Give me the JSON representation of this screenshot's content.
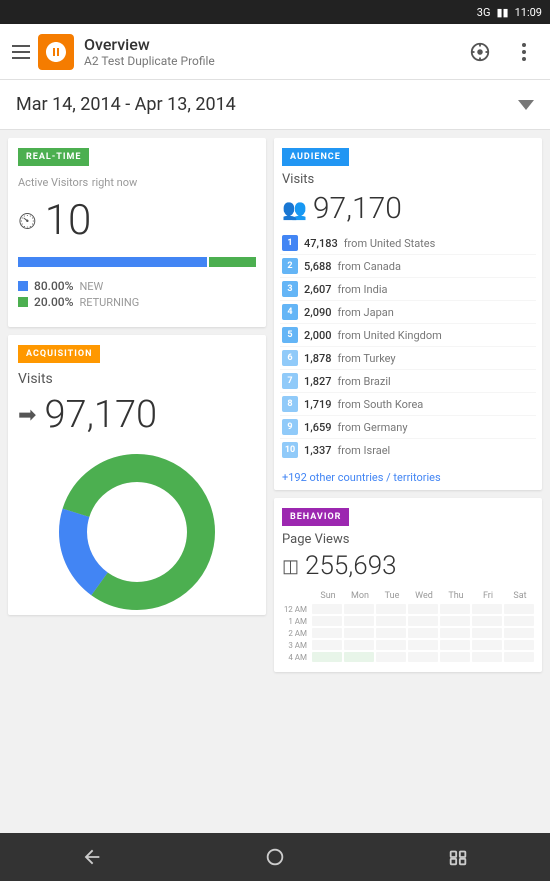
{
  "statusBar": {
    "signal": "3G",
    "time": "11:09"
  },
  "appBar": {
    "logoAlt": "Google Analytics",
    "title": "Overview",
    "subtitle": "A2 Test Duplicate Profile"
  },
  "dateRange": {
    "text": "Mar 14, 2014 - Apr 13, 2014"
  },
  "realtime": {
    "tag": "REAL-TIME",
    "visitorsLabel": "Active Visitors",
    "visitorsSubLabel": "right now",
    "visitorsCount": "10",
    "newPercent": "80.00%",
    "newLabel": "NEW",
    "returningPercent": "20.00%",
    "returningLabel": "RETURNING",
    "newBarWidth": "80",
    "returningBarWidth": "20"
  },
  "acquisition": {
    "tag": "ACQUISITION",
    "visitsLabel": "Visits",
    "visitsCount": "97,170"
  },
  "audience": {
    "tag": "AUDIENCE",
    "visitsLabel": "Visits",
    "visitsCount": "97,170",
    "countries": [
      {
        "rank": "1",
        "count": "47,183",
        "name": "from United States"
      },
      {
        "rank": "2",
        "count": "5,688",
        "name": "from Canada"
      },
      {
        "rank": "3",
        "count": "2,607",
        "name": "from India"
      },
      {
        "rank": "4",
        "count": "2,090",
        "name": "from Japan"
      },
      {
        "rank": "5",
        "count": "2,000",
        "name": "from United Kingdom"
      },
      {
        "rank": "6",
        "count": "1,878",
        "name": "from Turkey"
      },
      {
        "rank": "7",
        "count": "1,827",
        "name": "from Brazil"
      },
      {
        "rank": "8",
        "count": "1,719",
        "name": "from South Korea"
      },
      {
        "rank": "9",
        "count": "1,659",
        "name": "from Germany"
      },
      {
        "rank": "10",
        "count": "1,337",
        "name": "from Israel"
      }
    ],
    "otherCountries": "+192 other countries / territories"
  },
  "behavior": {
    "tag": "BEHAVIOR",
    "pageviewsLabel": "Page Views",
    "pageviewsCount": "255,693",
    "heatmapDays": [
      "Sun",
      "Mon",
      "Tue",
      "Wed",
      "Thu",
      "Fri",
      "Sat"
    ],
    "heatmapRows": [
      {
        "label": "12 AM",
        "cells": [
          0,
          0,
          0,
          0,
          0,
          0,
          0
        ]
      },
      {
        "label": "1 AM",
        "cells": [
          0,
          0,
          0,
          0,
          0,
          0,
          0
        ]
      },
      {
        "label": "2 AM",
        "cells": [
          0,
          0,
          0,
          0,
          0,
          0,
          0
        ]
      },
      {
        "label": "3 AM",
        "cells": [
          0,
          0,
          0,
          0,
          0,
          0,
          0
        ]
      },
      {
        "label": "4 AM",
        "cells": [
          1,
          1,
          0,
          0,
          0,
          0,
          0
        ]
      }
    ]
  },
  "bottomNav": {
    "backLabel": "back",
    "homeLabel": "home",
    "recentLabel": "recent"
  }
}
